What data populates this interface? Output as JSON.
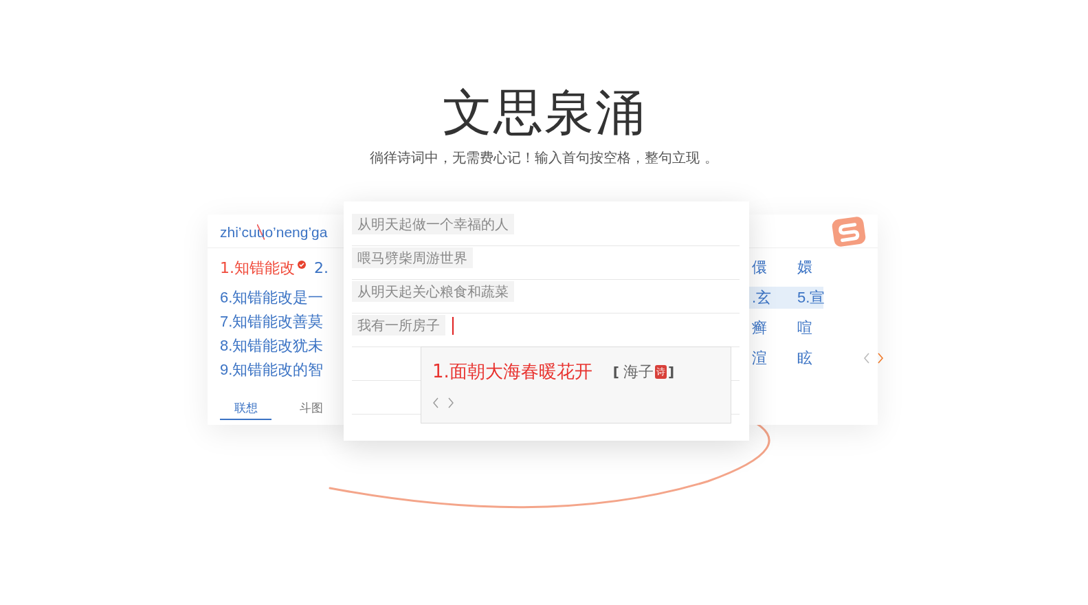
{
  "hero": {
    "title": "文思泉涌",
    "subtitle": "徜徉诗词中，无需费心记！输入首句按空格，整句立现 。"
  },
  "left_panel": {
    "pinyin": [
      {
        "text": "zhi’cu",
        "struck": false
      },
      {
        "text": "u",
        "struck": true
      },
      {
        "text": "o’neng’ga",
        "struck": false
      }
    ],
    "first_row": [
      {
        "text": "1.知错能改",
        "selected": true,
        "verified": true
      },
      {
        "text": "2.",
        "selected": false,
        "verified": false
      }
    ],
    "candidates": [
      "6.知错能改是一",
      "7.知错能改善莫",
      "8.知错能改犹未",
      "9.知错能改的智"
    ],
    "tabs": [
      {
        "label": "联想",
        "selected": true
      },
      {
        "label": "斗图",
        "selected": false
      }
    ]
  },
  "editor": {
    "lines": [
      {
        "text": "从明天起做一个幸福的人",
        "cursor": false
      },
      {
        "text": "喂马劈柴周游世界",
        "cursor": false
      },
      {
        "text": "从明天起关心粮食和蔬菜",
        "cursor": false
      },
      {
        "text": "我有一所房子",
        "cursor": true
      }
    ],
    "suggestion": {
      "text": "1.面朝大海春暖花开",
      "open_bracket": "[",
      "author": "海子",
      "badge": "诗",
      "close_bracket": "]"
    }
  },
  "right_panel": {
    "rows": [
      {
        "cells": [
          "儇",
          "嬛"
        ],
        "selected": false
      },
      {
        "cells": [
          ".玄",
          "5.宣"
        ],
        "selected": true
      },
      {
        "cells": [
          "癣",
          "喧"
        ],
        "selected": false
      },
      {
        "cells": [
          "渲",
          "眩"
        ],
        "selected": false
      }
    ],
    "prev_enabled": false,
    "next_enabled": true
  }
}
